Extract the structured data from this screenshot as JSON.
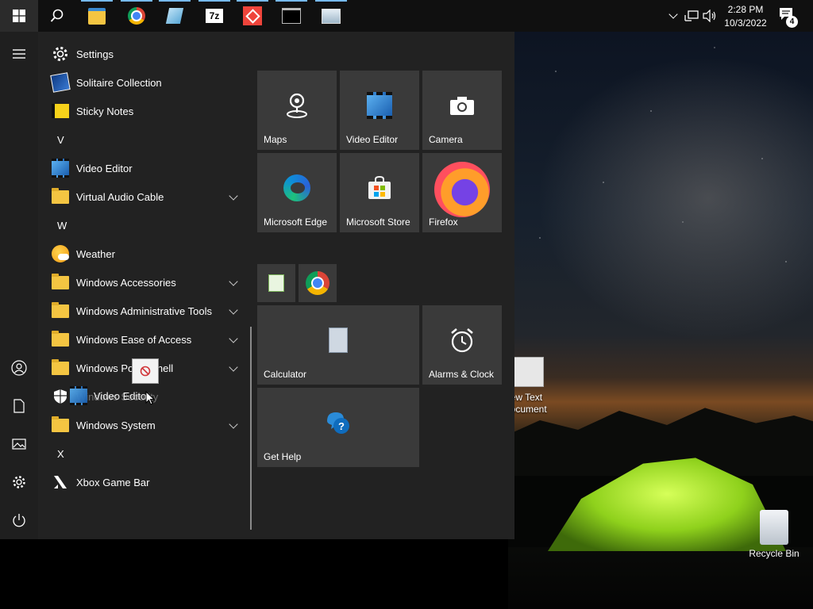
{
  "taskbar": {
    "time": "2:28 PM",
    "date": "10/3/2022",
    "notification_count": "4",
    "pinned": [
      "search-icon",
      "file-explorer-icon",
      "chrome-icon",
      "notepad-icon",
      "7zip-icon",
      "anydesk-icon",
      "terminal-icon",
      "remote-desktop-icon"
    ]
  },
  "apps": {
    "settings": "Settings",
    "solitaire": "Solitaire Collection",
    "sticky": "Sticky Notes",
    "letter_v": "V",
    "video_editor": "Video Editor",
    "vac": "Virtual Audio Cable",
    "letter_w": "W",
    "weather": "Weather",
    "accessories": "Windows Accessories",
    "admin_tools": "Windows Administrative Tools",
    "ease": "Windows Ease of Access",
    "powershell": "Windows PowerShell",
    "security": "Windows Security",
    "system": "Windows System",
    "letter_x": "X",
    "xbox": "Xbox Game Bar"
  },
  "drag": {
    "label": "Video Editor"
  },
  "tiles": {
    "maps": "Maps",
    "video_editor": "Video Editor",
    "camera": "Camera",
    "edge": "Microsoft Edge",
    "store": "Microsoft Store",
    "firefox": "Firefox",
    "calculator": "Calculator",
    "alarms": "Alarms & Clock",
    "gethelp": "Get Help"
  },
  "desktop": {
    "new_text_doc": "New Text Document",
    "recycle_bin": "Recycle Bin"
  }
}
